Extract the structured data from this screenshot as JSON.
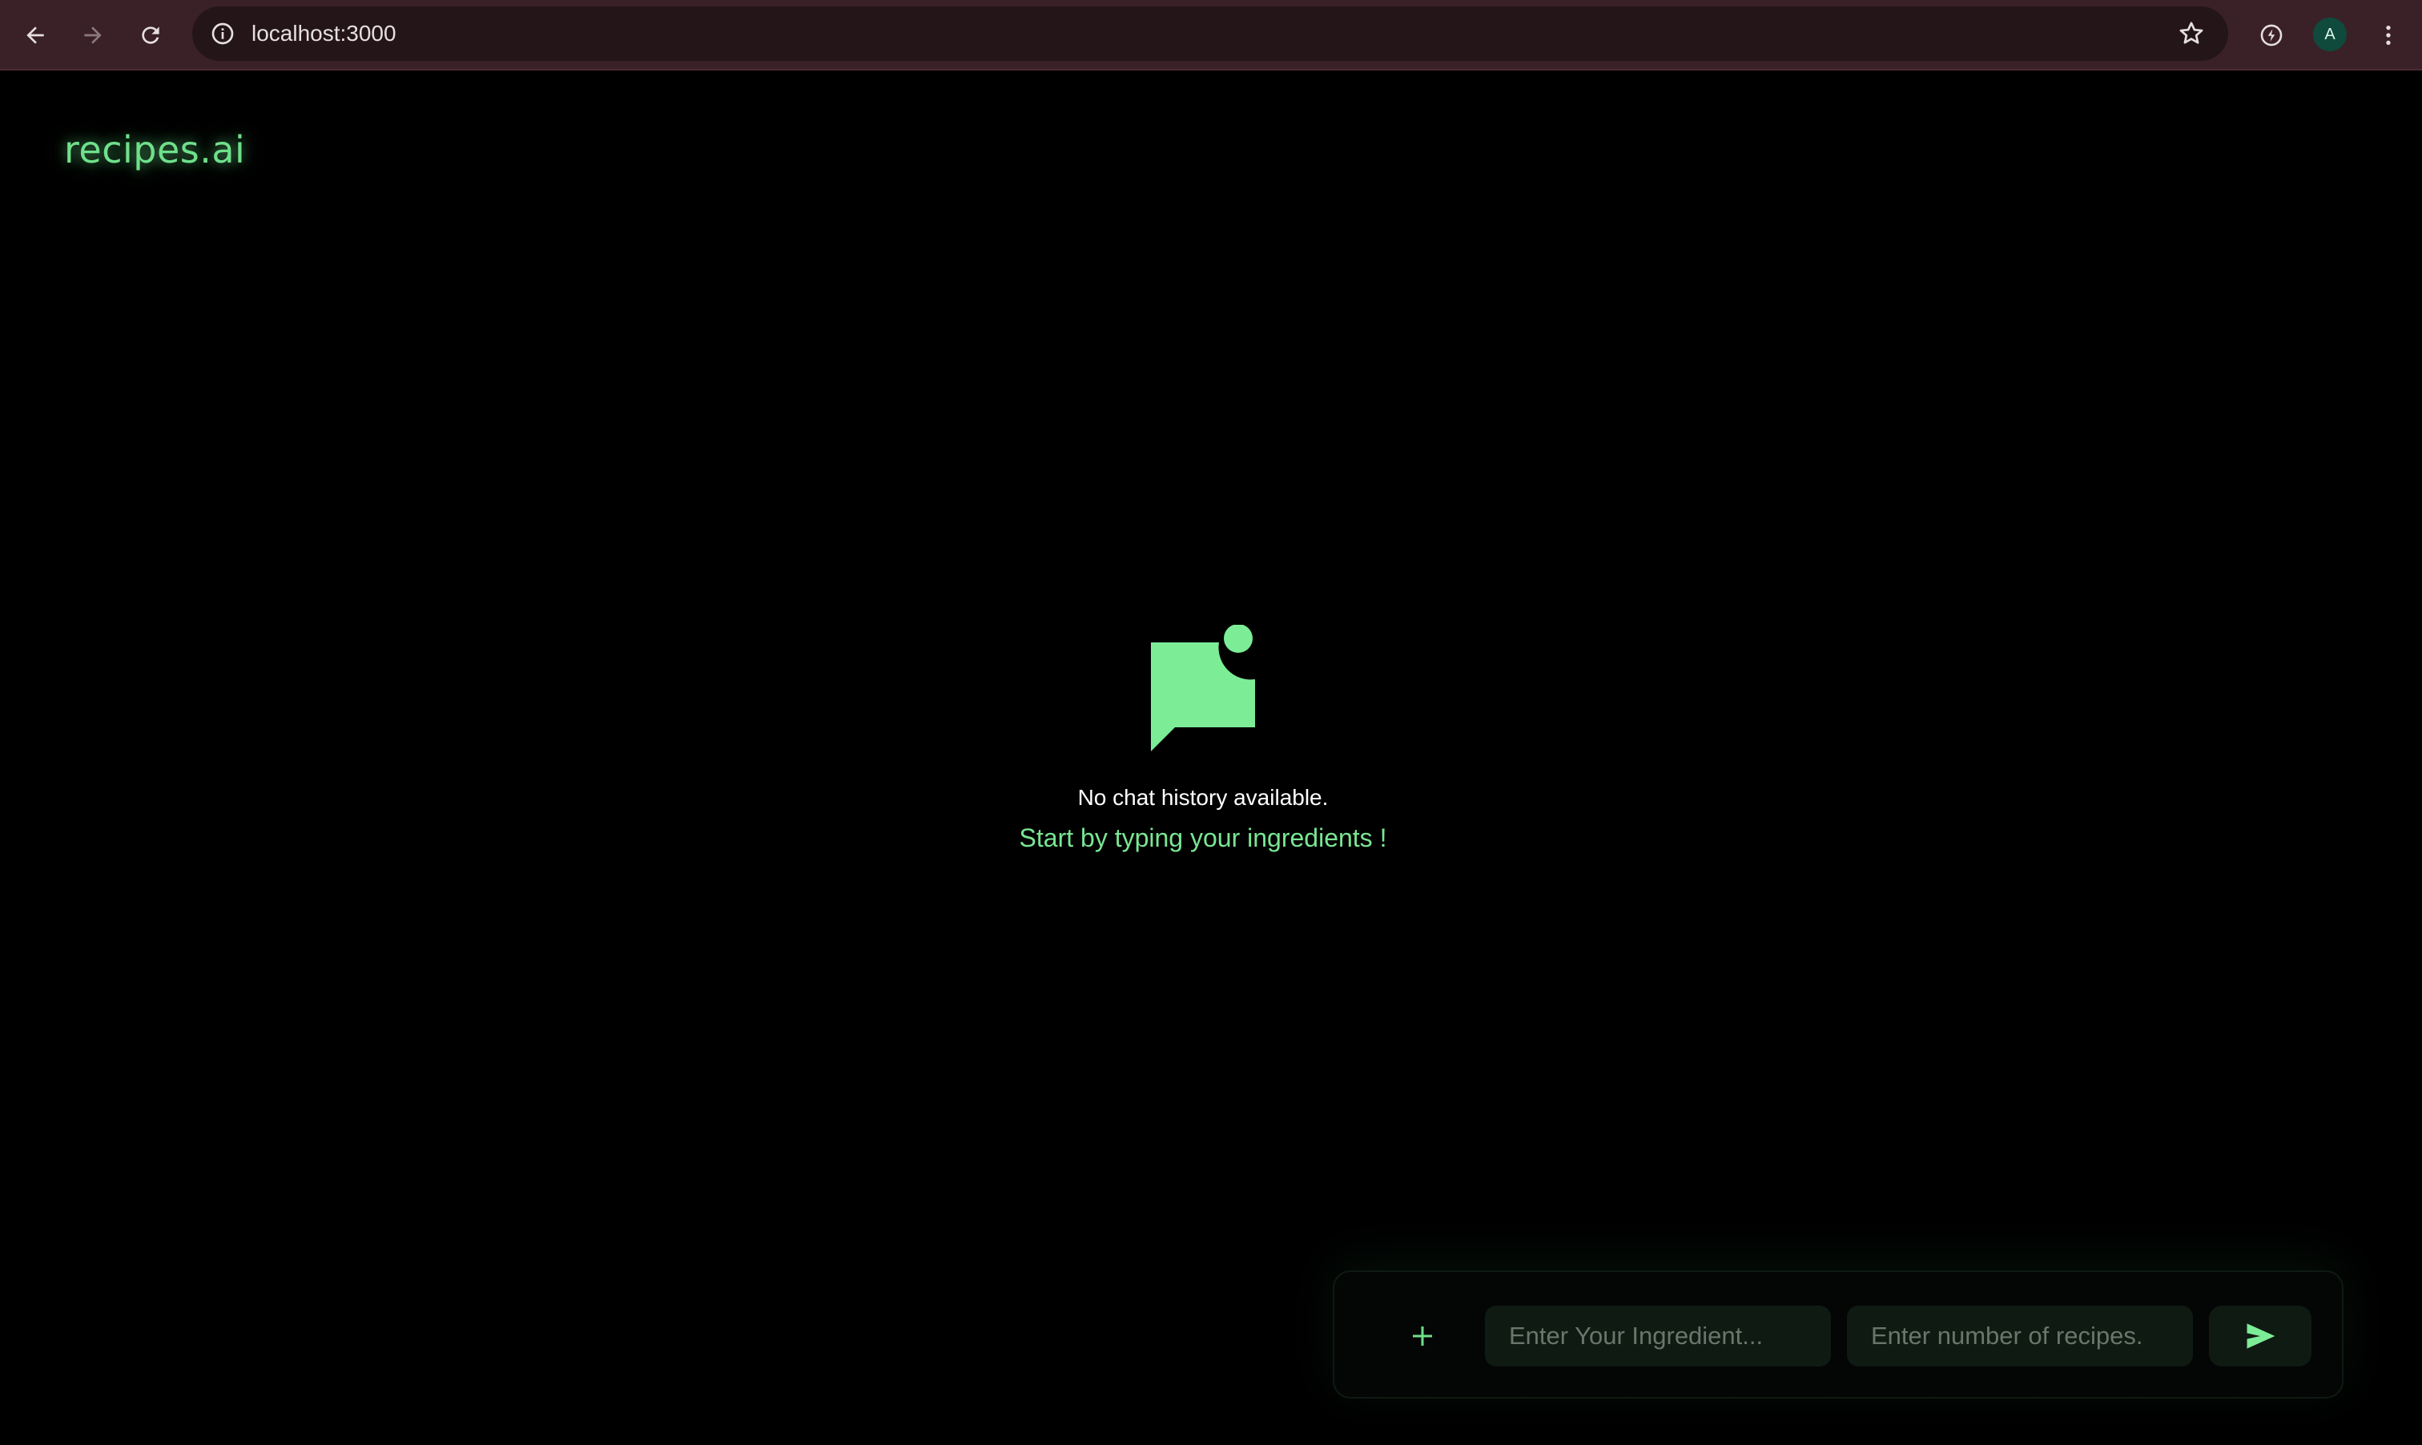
{
  "browser": {
    "url": "localhost:3000",
    "profile_initial": "A",
    "icons": {
      "back": "back-arrow-icon",
      "forward": "forward-arrow-icon",
      "reload": "reload-icon",
      "site_info": "info-icon",
      "bookmark": "star-icon",
      "extension": "extension-icon",
      "menu": "kebab-menu-icon"
    },
    "colors": {
      "toolbar": "#3a2127",
      "omnibox": "#231518",
      "avatar": "#0f4a3c"
    }
  },
  "app": {
    "brand": "recipes.ai",
    "accent_color": "#6fe08b"
  },
  "empty_state": {
    "icon": "chat-bubble-notification-icon",
    "title": "No chat history available.",
    "subtitle": "Start by typing your ingredients !"
  },
  "composer": {
    "add_icon": "plus-icon",
    "add_label": "+",
    "ingredient_placeholder": "Enter Your Ingredient...",
    "ingredient_value": "",
    "count_placeholder": "Enter number of recipes.",
    "count_value": "",
    "send_icon": "send-icon"
  }
}
